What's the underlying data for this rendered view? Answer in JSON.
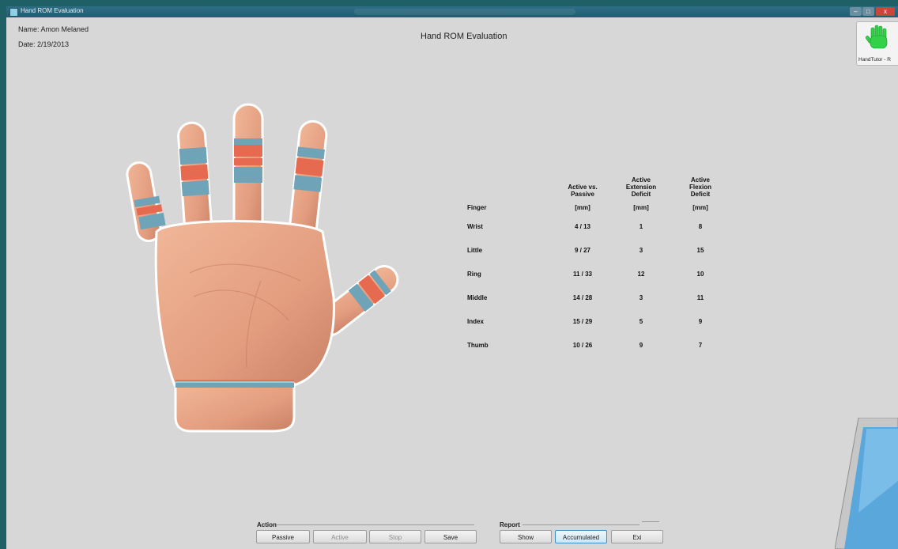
{
  "window": {
    "title": "Hand ROM Evaluation",
    "controls": {
      "minimize": "–",
      "maximize": "□",
      "close": "x"
    }
  },
  "header": {
    "name": "Name: Amon Melaned",
    "date": "Date: 2/19/2013",
    "title": "Hand ROM Evaluation"
  },
  "badge": {
    "label": "HandTutor - R",
    "icon": "green-hand-icon"
  },
  "table": {
    "headers": {
      "finger": "Finger",
      "col1": [
        "Active vs.",
        "Passive",
        "[mm]"
      ],
      "col2": [
        "Active",
        "Extension",
        "Deficit",
        "[mm]"
      ],
      "col3": [
        "Active",
        "Flexion",
        "Deficit",
        "[mm]"
      ]
    },
    "rows": [
      {
        "finger": "Wrist",
        "active_passive": "4 / 13",
        "ext_deficit": "1",
        "flex_deficit": "8"
      },
      {
        "finger": "Little",
        "active_passive": "9 / 27",
        "ext_deficit": "3",
        "flex_deficit": "15"
      },
      {
        "finger": "Ring",
        "active_passive": "11 / 33",
        "ext_deficit": "12",
        "flex_deficit": "10"
      },
      {
        "finger": "Middle",
        "active_passive": "14 / 28",
        "ext_deficit": "3",
        "flex_deficit": "11"
      },
      {
        "finger": "Index",
        "active_passive": "15 / 29",
        "ext_deficit": "5",
        "flex_deficit": "9"
      },
      {
        "finger": "Thumb",
        "active_passive": "10 / 26",
        "ext_deficit": "9",
        "flex_deficit": "7"
      }
    ]
  },
  "action": {
    "label": "Action",
    "buttons": {
      "passive": "Passive",
      "active": "Active",
      "stop": "Stop",
      "save": "Save"
    }
  },
  "report": {
    "label": "Report",
    "buttons": {
      "show": "Show",
      "accumulated": "Accumulated",
      "exit": "Exi"
    }
  },
  "colors": {
    "skin": "#e9a88a",
    "band_blue": "#6fa3b8",
    "band_red": "#e56a4f",
    "window_bg": "#d7d7d7",
    "titlebar": "#2b6a80"
  }
}
